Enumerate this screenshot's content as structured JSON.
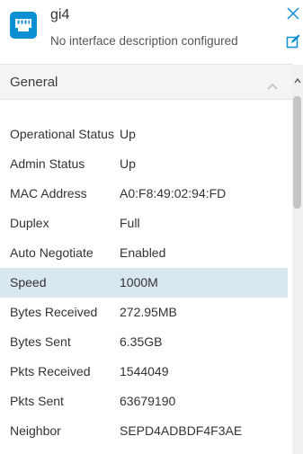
{
  "header": {
    "title": "gi4",
    "subtitle": "No interface description configured",
    "icon": "ethernet-port-icon",
    "icon_color": "#0a8ed4"
  },
  "section": {
    "title": "General",
    "collapse_icon": "chevron-up-icon"
  },
  "properties": [
    {
      "label": "Operational Status",
      "value": "Up"
    },
    {
      "label": "Admin Status",
      "value": "Up"
    },
    {
      "label": "MAC Address",
      "value": "A0:F8:49:02:94:FD"
    },
    {
      "label": "Duplex",
      "value": "Full"
    },
    {
      "label": "Auto Negotiate",
      "value": "Enabled"
    },
    {
      "label": "Speed",
      "value": "1000M"
    },
    {
      "label": "Bytes Received",
      "value": "272.95MB"
    },
    {
      "label": "Bytes Sent",
      "value": "6.35GB"
    },
    {
      "label": "Pkts Received",
      "value": "1544049"
    },
    {
      "label": "Pkts Sent",
      "value": "63679190"
    },
    {
      "label": "Neighbor",
      "value": "SEPD4ADBDF4F3AE"
    }
  ],
  "highlight_color": "#d9e7f0",
  "accent_color": "#0a8ed4"
}
